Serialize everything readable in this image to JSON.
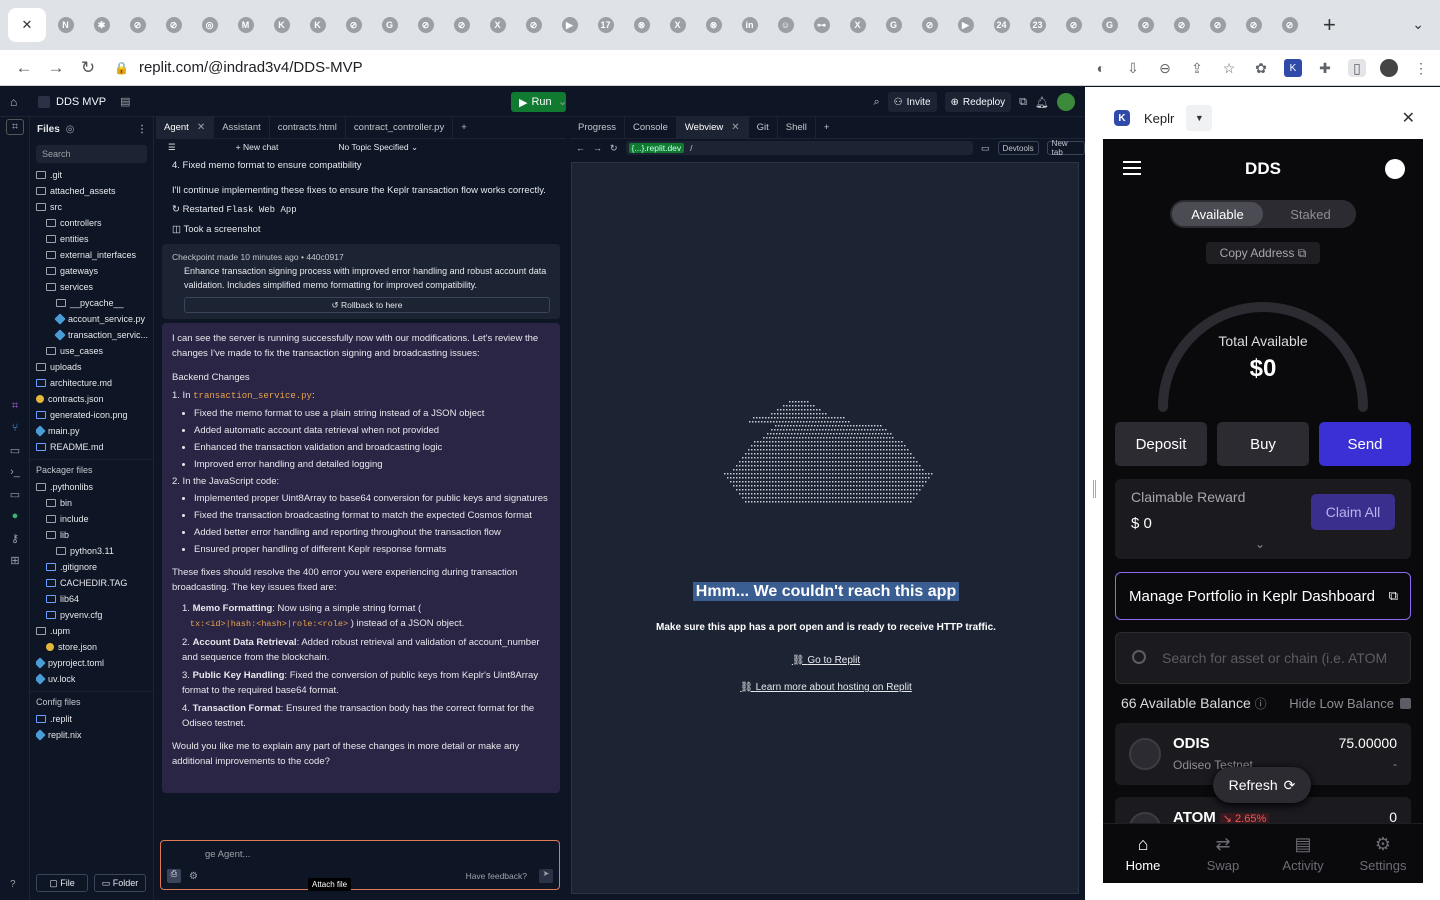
{
  "browser": {
    "tabs": [
      "N",
      "✱",
      "⊘",
      "⊘",
      "◎",
      "M",
      "K",
      "K",
      "⊘",
      "G",
      "⊘",
      "⊘",
      "X",
      "⊘",
      "▶",
      "17",
      "⊗",
      "X",
      "⊗",
      "in",
      "☺",
      "⊶",
      "X",
      "G",
      "⊘",
      "▶",
      "24",
      "23",
      "⊘",
      "G",
      "⊘",
      "⊘",
      "⊘",
      "⊘",
      "⊘"
    ],
    "url": "replit.com/@indrad3v4/DDS-MVP",
    "new_tab": "+"
  },
  "replit": {
    "project": "DDS MVP",
    "run": "Run",
    "invite": "Invite",
    "redeploy": "Redeploy",
    "files_title": "Files",
    "search_placeholder": "Search",
    "files": [
      {
        "name": ".git",
        "indent": 0,
        "type": "folder"
      },
      {
        "name": "attached_assets",
        "indent": 0,
        "type": "folder"
      },
      {
        "name": "src",
        "indent": 0,
        "type": "folder"
      },
      {
        "name": "controllers",
        "indent": 1,
        "type": "folder"
      },
      {
        "name": "entities",
        "indent": 1,
        "type": "folder"
      },
      {
        "name": "external_interfaces",
        "indent": 1,
        "type": "folder"
      },
      {
        "name": "gateways",
        "indent": 1,
        "type": "folder"
      },
      {
        "name": "services",
        "indent": 1,
        "type": "folder"
      },
      {
        "name": "__pycache__",
        "indent": 2,
        "type": "folder"
      },
      {
        "name": "account_service.py",
        "indent": 2,
        "type": "py"
      },
      {
        "name": "transaction_servic...",
        "indent": 2,
        "type": "py"
      },
      {
        "name": "use_cases",
        "indent": 1,
        "type": "folder"
      },
      {
        "name": "uploads",
        "indent": 0,
        "type": "folder"
      },
      {
        "name": "architecture.md",
        "indent": 0,
        "type": "file"
      },
      {
        "name": "contracts.json",
        "indent": 0,
        "type": "json"
      },
      {
        "name": "generated-icon.png",
        "indent": 0,
        "type": "file"
      },
      {
        "name": "main.py",
        "indent": 0,
        "type": "py"
      },
      {
        "name": "README.md",
        "indent": 0,
        "type": "file"
      }
    ],
    "packager_title": "Packager files",
    "packager": [
      {
        "name": ".pythonlibs",
        "indent": 0,
        "type": "folder"
      },
      {
        "name": "bin",
        "indent": 1,
        "type": "folder"
      },
      {
        "name": "include",
        "indent": 1,
        "type": "folder"
      },
      {
        "name": "lib",
        "indent": 1,
        "type": "folder"
      },
      {
        "name": "python3.11",
        "indent": 2,
        "type": "folder"
      },
      {
        "name": ".gitignore",
        "indent": 1,
        "type": "file"
      },
      {
        "name": "CACHEDIR.TAG",
        "indent": 1,
        "type": "file"
      },
      {
        "name": "lib64",
        "indent": 1,
        "type": "file"
      },
      {
        "name": "pyvenv.cfg",
        "indent": 1,
        "type": "file"
      },
      {
        "name": ".upm",
        "indent": 0,
        "type": "folder"
      },
      {
        "name": "store.json",
        "indent": 1,
        "type": "json"
      },
      {
        "name": "pyproject.toml",
        "indent": 0,
        "type": "py"
      },
      {
        "name": "uv.lock",
        "indent": 0,
        "type": "py"
      }
    ],
    "config_title": "Config files",
    "config": [
      {
        "name": ".replit",
        "indent": 0,
        "type": "file"
      },
      {
        "name": "replit.nix",
        "indent": 0,
        "type": "py"
      }
    ],
    "file_btn": "File",
    "folder_btn": "Folder",
    "agent_tabs": [
      "Agent",
      "Assistant",
      "contracts.html",
      "contract_controller.py"
    ],
    "new_chat": "New chat",
    "topic": "No Topic Specified",
    "pre_lines": [
      "4. Fixed memo format to ensure compatibility",
      "I'll continue implementing these fixes to ensure the Keplr transaction flow works correctly."
    ],
    "restarted": "Restarted",
    "restarted_code": "Flask Web App",
    "screenshot": "Took a screenshot",
    "checkpoint": {
      "meta": "Checkpoint made 10 minutes ago • 440c0917",
      "text": "Enhance transaction signing process with improved error handling and robust account data validation. Includes simplified memo formatting for improved compatibility.",
      "rollback": "Rollback to here"
    },
    "agent_msg": {
      "intro": "I can see the server is running successfully now with our modifications. Let's review the changes I've made to fix the transaction signing and broadcasting issues:",
      "backend": "Backend Changes",
      "s1_prefix": "1. In",
      "s1_code": "transaction_service.py",
      "s1_suffix": ":",
      "s1_items": [
        "Fixed the memo format to use a plain string instead of a JSON object",
        "Added automatic account data retrieval when not provided",
        "Enhanced the transaction validation and broadcasting logic",
        "Improved error handling and detailed logging"
      ],
      "s2": "2. In the JavaScript code:",
      "s2_items": [
        "Implemented proper Uint8Array to base64 conversion for public keys and signatures",
        "Fixed the transaction broadcasting format to match the expected Cosmos format",
        "Added better error handling and reporting throughout the transaction flow",
        "Ensured proper handling of different Keplr response formats"
      ],
      "issues_intro": "These fixes should resolve the 400 error you were experiencing during transaction broadcasting. The key issues fixed are:",
      "i1_title": "Memo Formatting",
      "i1_text": ": Now using a simple string format (",
      "i1_code": "tx:<id>|hash:<hash>|role:<role>",
      "i1_tail": ") instead of a JSON object.",
      "i2_title": "Account Data Retrieval",
      "i2_text": ": Added robust retrieval and validation of account_number and sequence from the blockchain.",
      "i3_title": "Public Key Handling",
      "i3_text": ": Fixed the conversion of public keys from Keplr's Uint8Array format to the required base64 format.",
      "i4_title": "Transaction Format",
      "i4_text": ": Ensured the transaction body has the correct format for the Odiseo testnet.",
      "outro": "Would you like me to explain any part of these changes in more detail or make any additional improvements to the code?"
    },
    "input_placeholder": "ge Agent...",
    "feedback": "Have feedback?",
    "tooltip": "Attach file",
    "web_tabs": [
      "Progress",
      "Console",
      "Webview",
      "Git",
      "Shell"
    ],
    "webview": {
      "domain": "{...}.replit.dev",
      "path": "/",
      "devtools": "Devtools",
      "newtab": "New tab",
      "title": "Hmm... We couldn't reach this app",
      "sub": "Make sure this app has a port open and is ready to receive HTTP traffic.",
      "link1": "Go to Replit",
      "link2": "Learn more about hosting on Replit"
    }
  },
  "keplr": {
    "name": "Keplr",
    "wallet_title": "DDS",
    "seg": [
      "Available",
      "Staked"
    ],
    "copy": "Copy Address",
    "total_label": "Total Available",
    "total_value": "$0",
    "deposit": "Deposit",
    "buy": "Buy",
    "send": "Send",
    "claim_label": "Claimable Reward",
    "claim_value": "$ 0",
    "claim_btn": "Claim All",
    "manage": "Manage Portfolio in Keplr Dashboard",
    "search": "Search for asset or chain (i.e. ATOM",
    "avail": "66 Available Balance",
    "hide": "Hide Low Balance",
    "assets": [
      {
        "name": "ODIS",
        "chain": "Odiseo Testnet",
        "amount": "75.00000",
        "usd": "-"
      },
      {
        "name": "ATOM",
        "change": "↘ 2.65%",
        "amount": "0"
      }
    ],
    "refresh": "Refresh",
    "nav": [
      "Home",
      "Swap",
      "Activity",
      "Settings"
    ],
    "accent": "#3b2fd6"
  }
}
